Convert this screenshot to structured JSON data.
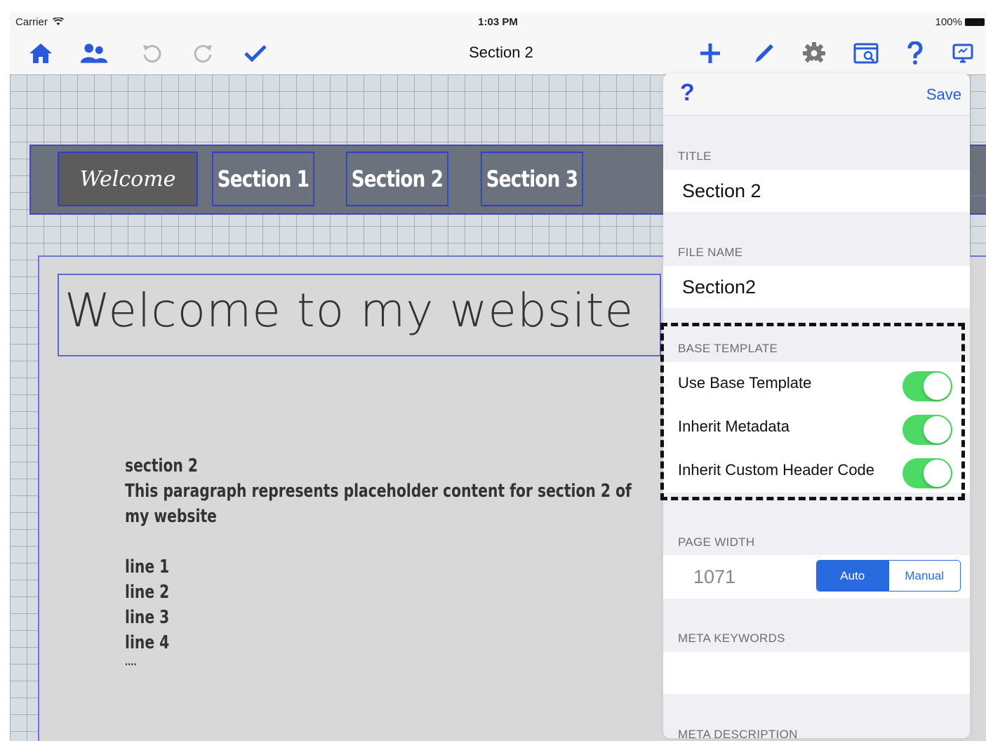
{
  "status_bar": {
    "carrier": "Carrier",
    "time": "1:03 PM",
    "battery": "100%"
  },
  "navbar": {
    "title": "Section 2",
    "icons": [
      "home-icon",
      "users-icon",
      "undo-icon",
      "redo-icon",
      "checkmark-icon",
      "plus-icon",
      "pencil-icon",
      "gear-icon",
      "preview-icon",
      "help-icon",
      "monitor-icon"
    ],
    "accent_color": "#2a5ad8"
  },
  "site": {
    "menu": [
      "Welcome",
      "Section 1",
      "Section 2",
      "Section 3"
    ],
    "headline": "Welcome to my website",
    "body_title": "section 2",
    "body_lines": [
      "This paragraph represents placeholder content for section 2 of",
      "my website"
    ],
    "list": [
      "line 1",
      "line 2",
      "line 3",
      "line 4"
    ],
    "ellipsis": "...."
  },
  "panel": {
    "help": "?",
    "save": "Save",
    "title_label": "TITLE",
    "title_value": "Section 2",
    "file_label": "FILE NAME",
    "file_value": "Section2",
    "base_label": "BASE TEMPLATE",
    "toggles": [
      {
        "label": "Use Base Template",
        "on": true
      },
      {
        "label": "Inherit Metadata",
        "on": true
      },
      {
        "label": "Inherit Custom Header Code",
        "on": true
      }
    ],
    "width_label": "PAGE WIDTH",
    "width_value": "1071",
    "width_modes": [
      "Auto",
      "Manual"
    ],
    "width_mode_selected": "Auto",
    "keywords_label": "META KEYWORDS",
    "keywords_value": "",
    "description_label": "META DESCRIPTION",
    "toggle_color": "#4cd964"
  }
}
